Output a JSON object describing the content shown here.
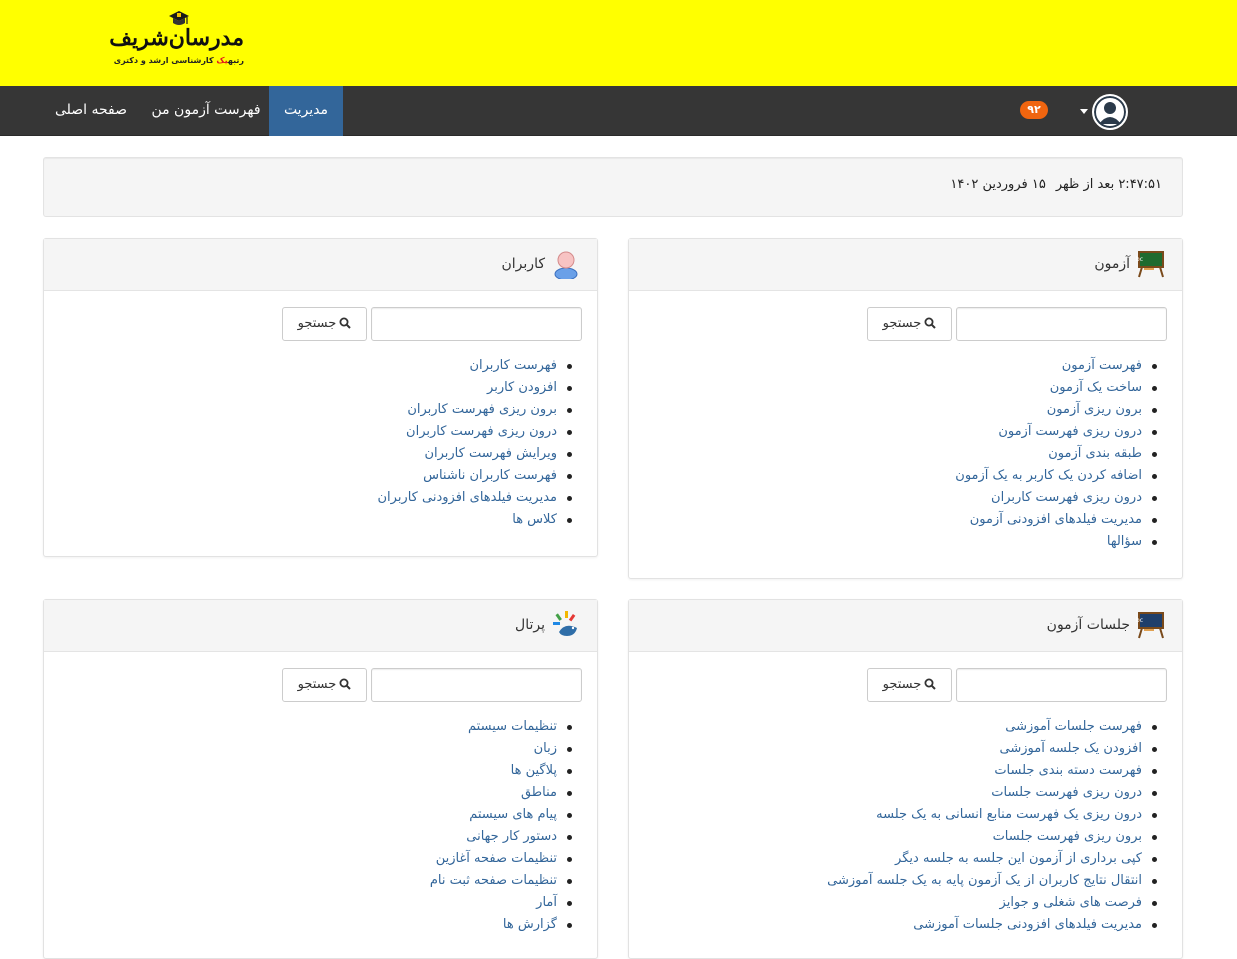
{
  "branding": {
    "logo_title": "مدرسان‌شریف",
    "logo_sub_prefix": "رتبه",
    "logo_sub_highlight": "یک",
    "logo_sub_suffix": " کارشناسی ارشد و دکتری"
  },
  "nav": {
    "home": "صفحه اصلی",
    "my_exams": "فهرست آزمون من",
    "admin": "مدیریت",
    "notification_count": "۹۲"
  },
  "clock": {
    "time": "۲:۴۷:۵۱ بعد از ظهر",
    "date": "۱۵ فروردین ۱۴۰۲"
  },
  "colors": {
    "header_bg": "#ffff00",
    "navbar_bg": "#363636",
    "active_nav": "#33669a",
    "link": "#33669a",
    "badge": "#f0650f"
  },
  "search_label": "جستجو",
  "panels": {
    "exam": {
      "title": "آزمون",
      "icon": "chalkboard-icon",
      "links": [
        "فهرست آزمون",
        "ساخت یک آزمون",
        "برون ریزی آزمون",
        "درون ریزی فهرست آزمون",
        "طبقه بندی آزمون",
        "اضافه کردن یک کاربر به یک آزمون",
        "درون ریزی فهرست کاربران",
        "مدیریت فیلدهای افزودنی آزمون",
        "سؤالها"
      ]
    },
    "users": {
      "title": "کاربران",
      "icon": "user-icon",
      "links": [
        "فهرست کاربران",
        "افزودن کاربر",
        "برون ریزی فهرست کاربران",
        "درون ریزی فهرست کاربران",
        "ویرایش فهرست کاربران",
        "فهرست کاربران ناشناس",
        "مدیریت فیلدهای افزودنی کاربران",
        "کلاس ها"
      ]
    },
    "sessions": {
      "title": "جلسات آزمون",
      "icon": "chalkboard-icon",
      "links": [
        "فهرست جلسات آموزشی",
        "افزودن یک جلسه آموزشی",
        "فهرست دسته بندی جلسات",
        "درون ریزی فهرست جلسات",
        "درون ریزی یک فهرست منابع انسانی به یک جلسه",
        "برون ریزی فهرست جلسات",
        "کپی برداری از آزمون این جلسه به جلسه دیگر",
        "انتقال نتایج کاربران از یک آزمون پایه به یک جلسه آموزشی",
        "فرصت های شغلی و جوایز",
        "مدیریت فیلدهای افزودنی جلسات آموزشی"
      ]
    },
    "portal": {
      "title": "پرتال",
      "icon": "portal-icon",
      "links": [
        "تنظیمات سیستم",
        "زبان",
        "پلاگین ها",
        "مناطق",
        "پیام های سیستم",
        "دستور کار جهانی",
        "تنظیمات صفحه آغازین",
        "تنظیمات صفحه ثبت نام",
        "آمار",
        "گزارش ها"
      ]
    }
  }
}
